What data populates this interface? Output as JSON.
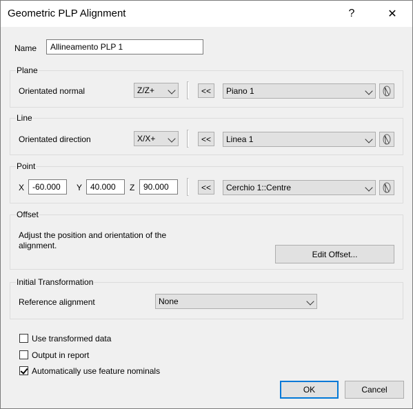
{
  "window": {
    "title": "Geometric PLP Alignment",
    "help_glyph": "?",
    "close_glyph": "✕"
  },
  "name": {
    "label": "Name",
    "value": "Allineamento PLP 1"
  },
  "plane": {
    "group_label": "Plane",
    "row_label": "Orientated normal",
    "axis_value": "Z/Z+",
    "arrow_label": "<<",
    "feature_value": "Piano 1"
  },
  "line": {
    "group_label": "Line",
    "row_label": "Orientated direction",
    "axis_value": "X/X+",
    "arrow_label": "<<",
    "feature_value": "Linea 1"
  },
  "point": {
    "group_label": "Point",
    "x_label": "X",
    "x_value": "-60.000",
    "y_label": "Y",
    "y_value": "40.000",
    "z_label": "Z",
    "z_value": "90.000",
    "arrow_label": "<<",
    "feature_value": "Cerchio 1::Centre"
  },
  "offset": {
    "group_label": "Offset",
    "description": "Adjust the position and orientation of the alignment.",
    "button_label": "Edit Offset..."
  },
  "initial": {
    "group_label": "Initial Transformation",
    "row_label": "Reference alignment",
    "value": "None"
  },
  "options": [
    {
      "label": "Use transformed data",
      "checked": false
    },
    {
      "label": "Output in report",
      "checked": false
    },
    {
      "label": "Automatically use feature nominals",
      "checked": true
    }
  ],
  "footer": {
    "ok_label": "OK",
    "cancel_label": "Cancel"
  }
}
